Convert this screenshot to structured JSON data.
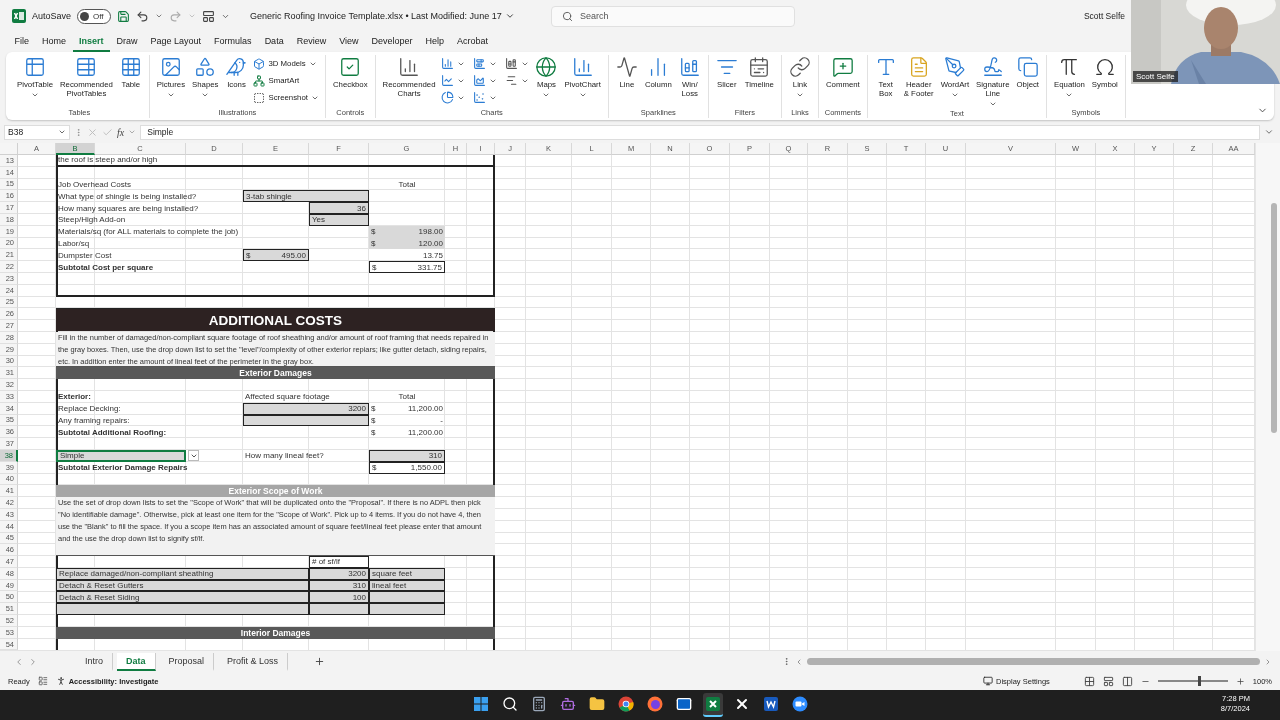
{
  "title_bar": {
    "autosave_label": "AutoSave",
    "autosave": {
      "on": false,
      "label": "Off"
    },
    "document_title": "Generic Roofing Invoice Template.xlsx • Last Modified: June 17",
    "search": {
      "placeholder": "Search"
    },
    "user": "Scott Selfe"
  },
  "webcam": {
    "kind": "picture",
    "name": "Scott Selfe"
  },
  "menu": [
    {
      "label": "File",
      "selected": false
    },
    {
      "label": "Home",
      "selected": false
    },
    {
      "label": "Insert",
      "selected": true
    },
    {
      "label": "Draw",
      "selected": false
    },
    {
      "label": "Page Layout",
      "selected": false
    },
    {
      "label": "Formulas",
      "selected": false
    },
    {
      "label": "Data",
      "selected": false
    },
    {
      "label": "Review",
      "selected": false
    },
    {
      "label": "View",
      "selected": false
    },
    {
      "label": "Developer",
      "selected": false
    },
    {
      "label": "Help",
      "selected": false
    },
    {
      "label": "Acrobat",
      "selected": false
    }
  ],
  "ribbon": [
    {
      "label": "Tables",
      "items": [
        {
          "kind": "large",
          "label": "PivotTable",
          "dropdown": true
        },
        {
          "kind": "large",
          "label": "Recommended\nPivotTables",
          "dropdown": false
        },
        {
          "kind": "large",
          "label": "Table",
          "dropdown": false
        }
      ]
    },
    {
      "label": "Illustrations",
      "items": [
        {
          "kind": "large",
          "label": "Pictures",
          "dropdown": true
        },
        {
          "kind": "large",
          "label": "Shapes",
          "dropdown": true
        },
        {
          "kind": "large",
          "label": "Icons",
          "dropdown": false
        },
        {
          "kind": "small",
          "label": "3D Models",
          "dropdown": true
        },
        {
          "kind": "small",
          "label": "SmartArt",
          "dropdown": false
        },
        {
          "kind": "small",
          "label": "Screenshot",
          "dropdown": true
        }
      ]
    },
    {
      "label": "Controls",
      "items": [
        {
          "kind": "large",
          "label": "Checkbox",
          "dropdown": false
        }
      ]
    },
    {
      "label": "Charts",
      "items": [
        {
          "kind": "large",
          "label": "Recommended\nCharts",
          "dropdown": false
        },
        {
          "kind": "chart",
          "dropdown": true
        },
        {
          "kind": "chart",
          "dropdown": true
        },
        {
          "kind": "chart",
          "dropdown": true
        },
        {
          "kind": "chart",
          "dropdown": true
        },
        {
          "kind": "chart",
          "dropdown": true
        },
        {
          "kind": "chart",
          "dropdown": true
        },
        {
          "kind": "chart",
          "dropdown": true
        },
        {
          "kind": "chart",
          "dropdown": true
        },
        {
          "kind": "large",
          "label": "Maps",
          "dropdown": true
        },
        {
          "kind": "large",
          "label": "PivotChart",
          "dropdown": true
        }
      ]
    },
    {
      "label": "Sparklines",
      "items": [
        {
          "kind": "large",
          "label": "Line",
          "dropdown": false
        },
        {
          "kind": "large",
          "label": "Column",
          "dropdown": false
        },
        {
          "kind": "large",
          "label": "Win/\nLoss",
          "dropdown": false
        }
      ]
    },
    {
      "label": "Filters",
      "items": [
        {
          "kind": "large",
          "label": "Slicer",
          "dropdown": false
        },
        {
          "kind": "large",
          "label": "Timeline",
          "dropdown": false
        }
      ]
    },
    {
      "label": "Links",
      "items": [
        {
          "kind": "large",
          "label": "Link",
          "dropdown": true
        }
      ]
    },
    {
      "label": "Comments",
      "items": [
        {
          "kind": "large",
          "label": "Comment",
          "dropdown": false
        }
      ]
    },
    {
      "label": "Text",
      "items": [
        {
          "kind": "large",
          "label": "Text\nBox",
          "dropdown": false
        },
        {
          "kind": "large",
          "label": "Header\n& Footer",
          "dropdown": false
        },
        {
          "kind": "large",
          "label": "WordArt",
          "dropdown": true
        },
        {
          "kind": "large",
          "label": "Signature\nLine",
          "dropdown": true
        },
        {
          "kind": "large",
          "label": "Object",
          "dropdown": false
        }
      ]
    },
    {
      "label": "Symbols",
      "items": [
        {
          "kind": "large",
          "label": "Equation",
          "dropdown": true
        },
        {
          "kind": "large",
          "label": "Symbol",
          "dropdown": false
        }
      ]
    }
  ],
  "formula_bar": {
    "name_box": "B38",
    "function_label": "fx",
    "formula": "Simple"
  },
  "sheet": {
    "columns": [
      {
        "label": "A",
        "selected": false
      },
      {
        "label": "B",
        "selected": true
      },
      {
        "label": "C",
        "selected": false
      },
      {
        "label": "D",
        "selected": false
      },
      {
        "label": "E",
        "selected": false
      },
      {
        "label": "F",
        "selected": false
      },
      {
        "label": "G",
        "selected": false
      },
      {
        "label": "H",
        "selected": false
      },
      {
        "label": "I",
        "selected": false
      },
      {
        "label": "J",
        "selected": false
      },
      {
        "label": "K",
        "selected": false
      },
      {
        "label": "L",
        "selected": false
      },
      {
        "label": "M",
        "selected": false
      },
      {
        "label": "N",
        "selected": false
      },
      {
        "label": "O",
        "selected": false
      },
      {
        "label": "P",
        "selected": false
      },
      {
        "label": "Q",
        "selected": false
      },
      {
        "label": "R",
        "selected": false
      },
      {
        "label": "S",
        "selected": false
      },
      {
        "label": "T",
        "selected": false
      },
      {
        "label": "U",
        "selected": false
      },
      {
        "label": "V",
        "selected": false
      },
      {
        "label": "W",
        "selected": false
      },
      {
        "label": "X",
        "selected": false
      },
      {
        "label": "Y",
        "selected": false
      },
      {
        "label": "Z",
        "selected": false
      },
      {
        "label": "AA",
        "selected": false
      }
    ],
    "rows": [
      {
        "number": "13",
        "selected": false,
        "cells": [
          {
            "kind": "note",
            "text": "the roof is steep and/or high"
          }
        ]
      },
      {
        "number": "14",
        "selected": false
      },
      {
        "number": "15",
        "selected": false,
        "cells": [
          {
            "kind": "label",
            "text": "Job Overhead Costs",
            "bold": false
          },
          {
            "kind": "total_head",
            "text": "Total"
          }
        ]
      },
      {
        "number": "16",
        "selected": false,
        "cells": [
          {
            "kind": "label",
            "text": "What type of shingle is being installed?",
            "bold": false
          },
          {
            "kind": "text_field_ef",
            "text": "3-tab shingle"
          }
        ]
      },
      {
        "number": "17",
        "selected": false,
        "cells": [
          {
            "kind": "label",
            "text": "How many squares are being installed?",
            "bold": false
          },
          {
            "kind": "number_field_f",
            "text": "36"
          }
        ]
      },
      {
        "number": "18",
        "selected": false,
        "cells": [
          {
            "kind": "label",
            "text": "Steep/High Add-on",
            "bold": false
          },
          {
            "kind": "text_field_f",
            "text": "Yes"
          }
        ]
      },
      {
        "number": "19",
        "selected": false,
        "cells": [
          {
            "kind": "label",
            "text": "Materials/sq (for ALL materials to complete the job)",
            "bold": false
          },
          {
            "kind": "money_shaded",
            "currency": "$",
            "text": "198.00"
          }
        ]
      },
      {
        "number": "20",
        "selected": false,
        "cells": [
          {
            "kind": "label",
            "text": "Labor/sq",
            "bold": false
          },
          {
            "kind": "money_shaded",
            "currency": "$",
            "text": "120.00"
          }
        ]
      },
      {
        "number": "21",
        "selected": false,
        "cells": [
          {
            "kind": "label",
            "text": "Dumpster Cost",
            "bold": false
          },
          {
            "kind": "money_field_e",
            "currency": "$",
            "text": "495.00"
          },
          {
            "kind": "number_g",
            "text": "13.75"
          }
        ]
      },
      {
        "number": "22",
        "selected": false,
        "cells": [
          {
            "kind": "label",
            "text": "Subtotal Cost per square",
            "bold": true
          },
          {
            "kind": "money_boxed",
            "currency": "$",
            "text": "331.75"
          }
        ]
      },
      {
        "number": "23",
        "selected": false
      },
      {
        "number": "24",
        "selected": false
      },
      {
        "number": "25",
        "selected": false
      },
      {
        "number": "26",
        "selected": false,
        "cells": [
          {
            "kind": "banner",
            "text": "ADDITIONAL COSTS"
          }
        ]
      },
      {
        "number": "27",
        "selected": false
      },
      {
        "number": "28",
        "selected": false,
        "cells": [
          {
            "kind": "paragraph",
            "text": "Fill in the number of damaged/non-compliant square footage of roof sheathing and/or amount of roof framing that needs repaired in the gray boxes.  Then, use the drop down list to set the \"level\"/complexity of other exterior repiars; like gutter detach, siding repairs, etc.  In addition enter the amount of lineal feet of the perimeter in the gray box."
          }
        ]
      },
      {
        "number": "29",
        "selected": false
      },
      {
        "number": "30",
        "selected": false
      },
      {
        "number": "31",
        "selected": false,
        "cells": [
          {
            "kind": "band",
            "text": "Exterior Damages"
          }
        ]
      },
      {
        "number": "32",
        "selected": false
      },
      {
        "number": "33",
        "selected": false,
        "cells": [
          {
            "kind": "label",
            "text": "Exterior:",
            "bold": true
          },
          {
            "kind": "prompt_e",
            "text": "Affected square footage"
          },
          {
            "kind": "total_head",
            "text": "Total"
          }
        ]
      },
      {
        "number": "34",
        "selected": false,
        "cells": [
          {
            "kind": "label",
            "text": "Replace Decking:",
            "bold": false
          },
          {
            "kind": "number_field_ef",
            "text": "3200"
          },
          {
            "kind": "money",
            "currency": "$",
            "text": "11,200.00"
          }
        ]
      },
      {
        "number": "35",
        "selected": false,
        "cells": [
          {
            "kind": "label",
            "text": "Any framing repairs:",
            "bold": false
          },
          {
            "kind": "empty_field_ef"
          },
          {
            "kind": "money",
            "currency": "$",
            "text": "-"
          }
        ]
      },
      {
        "number": "36",
        "selected": false,
        "cells": [
          {
            "kind": "label",
            "text": "Subtotal Additional Roofing:",
            "bold": true
          },
          {
            "kind": "money",
            "currency": "$",
            "text": "11,200.00"
          }
        ]
      },
      {
        "number": "37",
        "selected": false
      },
      {
        "number": "38",
        "selected": true,
        "cells": [
          {
            "kind": "dropdown_b",
            "text": "Simple"
          },
          {
            "kind": "prompt_e",
            "text": "How many lineal feet?"
          },
          {
            "kind": "number_field_g",
            "text": "310"
          }
        ]
      },
      {
        "number": "39",
        "selected": false,
        "cells": [
          {
            "kind": "label",
            "text": "Subtotal Exterior Damage Repairs",
            "bold": true
          },
          {
            "kind": "money_boxed",
            "currency": "$",
            "text": "1,550.00"
          }
        ]
      },
      {
        "number": "40",
        "selected": false
      },
      {
        "number": "41",
        "selected": false,
        "cells": [
          {
            "kind": "band_light",
            "text": "Exterior Scope of Work"
          }
        ]
      },
      {
        "number": "42",
        "selected": false,
        "cells": [
          {
            "kind": "paragraph",
            "text": "Use the set of drop down lists to set the \"Scope of Work\" that will be duplicated onto the \"Proposal\". If there is no ADPL then pick \"No identifiable damage\". Otherwise, pick at least one item for the \"Scope of Work\". Pick up to 4 items. If you do not have 4, then use the \"Blank\" to fill the space.  If you a scope item has an associated amount of square feet/lineal feet please enter that amount and the use the drop down list to signify sf/lf."
          }
        ]
      },
      {
        "number": "43",
        "selected": false
      },
      {
        "number": "44",
        "selected": false
      },
      {
        "number": "45",
        "selected": false
      },
      {
        "number": "46",
        "selected": false
      },
      {
        "number": "47",
        "selected": false,
        "cells": [
          {
            "kind": "sf_head",
            "text": "# of sf/lf"
          }
        ]
      },
      {
        "number": "48",
        "selected": false,
        "cells": [
          {
            "kind": "scope_desc",
            "text": "Replace damaged/non-compliant sheathing"
          },
          {
            "kind": "scope_num",
            "text": "3200"
          },
          {
            "kind": "scope_unit",
            "text": "square feet"
          }
        ]
      },
      {
        "number": "49",
        "selected": false,
        "cells": [
          {
            "kind": "scope_desc",
            "text": "Detach & Reset Gutters"
          },
          {
            "kind": "scope_num",
            "text": "310"
          },
          {
            "kind": "scope_unit",
            "text": "lineal feet"
          }
        ]
      },
      {
        "number": "50",
        "selected": false,
        "cells": [
          {
            "kind": "scope_desc",
            "text": "Detach & Reset Siding"
          },
          {
            "kind": "scope_num",
            "text": "100"
          },
          {
            "kind": "scope_unit"
          }
        ]
      },
      {
        "number": "51",
        "selected": false,
        "cells": [
          {
            "kind": "scope_desc"
          },
          {
            "kind": "scope_num"
          },
          {
            "kind": "scope_unit"
          }
        ]
      },
      {
        "number": "52",
        "selected": false
      },
      {
        "number": "53",
        "selected": false,
        "cells": [
          {
            "kind": "band",
            "text": "Interior Damages"
          }
        ]
      },
      {
        "number": "54",
        "selected": false
      }
    ]
  },
  "sheet_tabs": [
    {
      "label": "Intro",
      "selected": false
    },
    {
      "label": "Data",
      "selected": true
    },
    {
      "label": "Proposal",
      "selected": false
    },
    {
      "label": "Profit & Loss",
      "selected": false
    }
  ],
  "status_bar": {
    "ready": "Ready",
    "accessibility": "Accessibility: Investigate",
    "display_settings": "Display Settings",
    "zoom": {
      "level": 0.6
    },
    "zoom_label": "100%"
  },
  "taskbar": {
    "apps": [
      {
        "kind": "start",
        "active": false
      },
      {
        "kind": "search",
        "active": false
      },
      {
        "kind": "calculator",
        "active": false
      },
      {
        "kind": "assistant",
        "active": false
      },
      {
        "kind": "folder",
        "active": false
      },
      {
        "kind": "chrome",
        "active": false
      },
      {
        "kind": "firefox",
        "active": false
      },
      {
        "kind": "outlook",
        "active": false
      },
      {
        "kind": "excel",
        "active": true
      },
      {
        "kind": "x",
        "active": false
      },
      {
        "kind": "word",
        "active": false
      },
      {
        "kind": "zoom",
        "active": false
      }
    ],
    "time": "7:28 PM",
    "date": "8/7/2024"
  }
}
